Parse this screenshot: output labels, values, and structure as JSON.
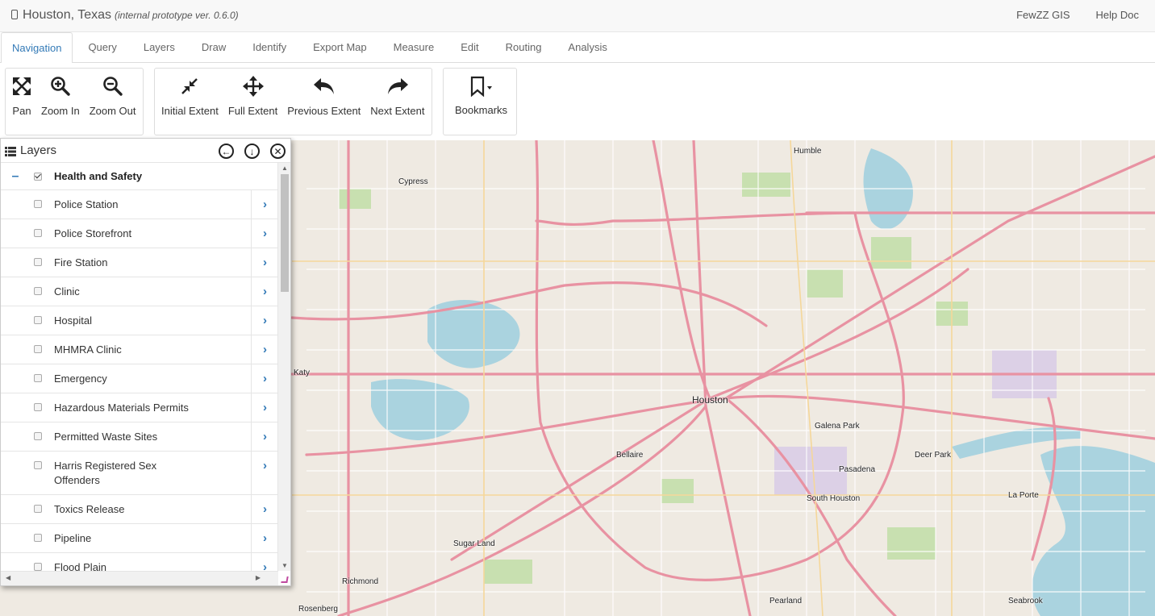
{
  "header": {
    "title": "Houston, Texas",
    "subtitle": "(internal prototype ver. 0.6.0)",
    "links": [
      "FewZZ GIS",
      "Help Doc"
    ]
  },
  "tabs": [
    {
      "label": "Navigation",
      "active": true
    },
    {
      "label": "Query"
    },
    {
      "label": "Layers"
    },
    {
      "label": "Draw"
    },
    {
      "label": "Identify"
    },
    {
      "label": "Export Map"
    },
    {
      "label": "Measure"
    },
    {
      "label": "Edit"
    },
    {
      "label": "Routing"
    },
    {
      "label": "Analysis"
    }
  ],
  "toolbar": {
    "pan": {
      "label": "Pan",
      "icon": "pan-icon"
    },
    "zoom_in": {
      "label": "Zoom In",
      "icon": "zoom-in-icon"
    },
    "zoom_out": {
      "label": "Zoom Out",
      "icon": "zoom-out-icon"
    },
    "initial_extent": {
      "label": "Initial Extent",
      "icon": "compress-icon"
    },
    "full_extent": {
      "label": "Full Extent",
      "icon": "move-icon"
    },
    "previous_extent": {
      "label": "Previous Extent",
      "icon": "back-arrow-icon"
    },
    "next_extent": {
      "label": "Next Extent",
      "icon": "forward-arrow-icon"
    },
    "bookmarks": {
      "label": "Bookmarks",
      "icon": "bookmark-icon"
    }
  },
  "layers_panel": {
    "title": "Layers",
    "group": {
      "label": "Health and Safety",
      "checked": true
    },
    "items": [
      {
        "label": "Police Station"
      },
      {
        "label": "Police Storefront"
      },
      {
        "label": "Fire Station"
      },
      {
        "label": "Clinic"
      },
      {
        "label": "Hospital"
      },
      {
        "label": "MHMRA Clinic"
      },
      {
        "label": "Emergency"
      },
      {
        "label": "Hazardous Materials Permits"
      },
      {
        "label": "Permitted Waste Sites"
      },
      {
        "label": "Harris Registered Sex Offenders"
      },
      {
        "label": "Toxics Release"
      },
      {
        "label": "Pipeline"
      },
      {
        "label": "Flood Plain"
      }
    ]
  },
  "map": {
    "places": [
      "Cypress",
      "Humble",
      "Katy",
      "Houston",
      "Bellaire",
      "Galena Park",
      "Pasadena",
      "Deer Park",
      "South Houston",
      "Sugar Land",
      "La Porte",
      "Richmond",
      "Rosenberg",
      "Pearland",
      "Seabrook"
    ],
    "colors": {
      "land": "#efeae2",
      "water": "#aad3df",
      "park": "#c8e0b0",
      "highway": "#e892a2",
      "road": "#ffffff"
    }
  }
}
